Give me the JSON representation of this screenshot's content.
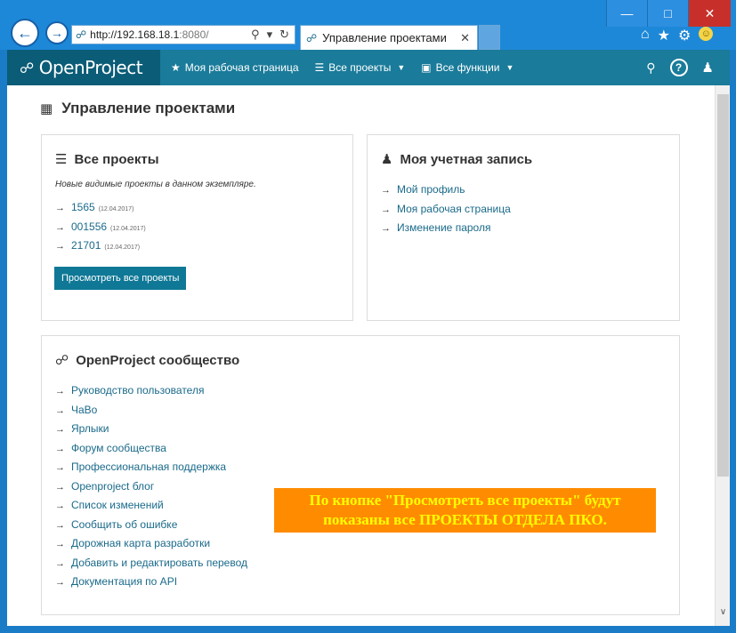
{
  "browser": {
    "url_host": "http://192.168.18.1",
    "url_port": ":8080/",
    "tab_title": "Управление проектами"
  },
  "header": {
    "logo": "OpenProject",
    "nav": [
      {
        "label": "Моя рабочая страница"
      },
      {
        "label": "Все проекты"
      },
      {
        "label": "Все функции"
      }
    ],
    "help": "?"
  },
  "page": {
    "title": "Управление проектами"
  },
  "all_projects": {
    "title": "Все проекты",
    "description": "Новые видимые проекты в данном экземпляре.",
    "projects": [
      {
        "name": "1565",
        "date": "(12.04.2017)"
      },
      {
        "name": "001556",
        "date": "(12.04.2017)"
      },
      {
        "name": "21701",
        "date": "(12.04.2017)"
      }
    ],
    "button": "Просмотреть все проекты"
  },
  "account": {
    "title": "Моя учетная запись",
    "links": [
      "Мой профиль",
      "Моя рабочая страница",
      "Изменение пароля"
    ]
  },
  "community": {
    "title": "OpenProject сообщество",
    "links": [
      "Руководство пользователя",
      "ЧаВо",
      "Ярлыки",
      "Форум сообщества",
      "Профессиональная поддержка",
      "Openproject блог",
      "Список изменений",
      "Сообщить об ошибке",
      "Дорожная карта разработки",
      "Добавить и редактировать перевод",
      "Документация по API"
    ]
  },
  "notice": {
    "line1": "По кнопке \"Просмотреть все проекты\" будут",
    "line2": "показаны все ПРОЕКТЫ ОТДЕЛА ПКО."
  },
  "colors": {
    "header": "#1a7b9a",
    "logo_bg": "#0b5c77",
    "link": "#1a6a8a",
    "button": "#0f7896",
    "notice_bg": "#ff8c00",
    "notice_text": "#ffff00"
  }
}
